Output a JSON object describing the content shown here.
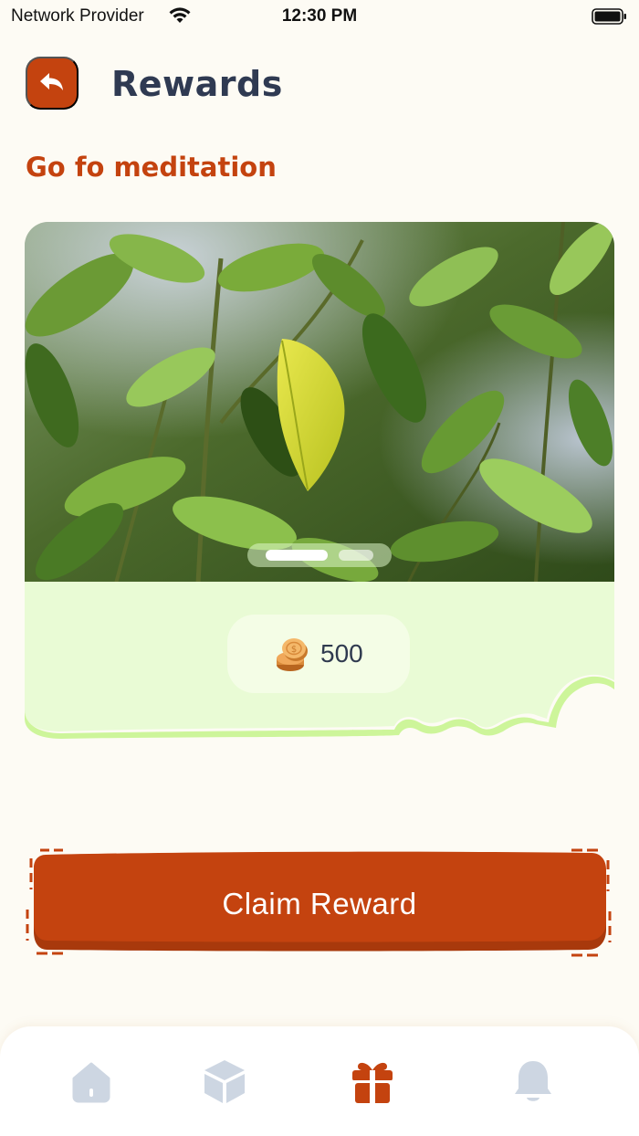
{
  "status_bar": {
    "carrier": "Network Provider",
    "time": "12:30 PM"
  },
  "header": {
    "title": "Rewards",
    "back_icon": "back-arrow-icon"
  },
  "task": {
    "title": "Go fo meditation"
  },
  "reward": {
    "image_subject": "green leaves photo",
    "carousel_active_index": 0,
    "carousel_count": 2,
    "coins": "500",
    "coin_icon": "coin-stack-icon"
  },
  "actions": {
    "claim_label": "Claim Reward"
  },
  "bottom_nav": {
    "items": [
      {
        "icon": "home-icon",
        "active": false
      },
      {
        "icon": "cube-icon",
        "active": false
      },
      {
        "icon": "gift-icon",
        "active": true
      },
      {
        "icon": "bell-icon",
        "active": false
      }
    ]
  },
  "colors": {
    "accent": "#c4430f",
    "background": "#fdfbf4",
    "panel": "#e9fbd5",
    "panel_border": "#cdf59a",
    "nav_inactive": "#cdd6e2",
    "title": "#2f3a52"
  }
}
